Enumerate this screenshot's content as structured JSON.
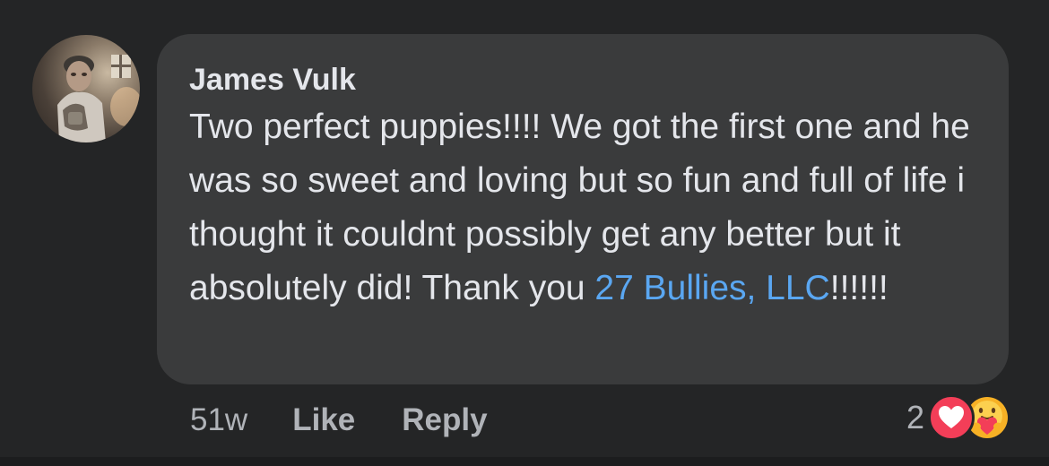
{
  "comment": {
    "author": "James Vulk",
    "text_before_mention": "Two perfect puppies!!!! We got the first one and he was so sweet and loving but so fun and full of life i thought it couldnt possibly get any better but it absolutely did! Thank you ",
    "mention": "27 Bullies, LLC",
    "text_after_mention": "!!!!!!",
    "timestamp": "51w",
    "like_label": "Like",
    "reply_label": "Reply",
    "reaction_count": "2",
    "reactions": [
      "heart-reaction-icon",
      "care-reaction-icon"
    ]
  },
  "colors": {
    "background": "#242526",
    "bubble": "#3a3b3c",
    "text": "#e4e6eb",
    "secondary_text": "#b0b3b8",
    "mention": "#5aa7f2",
    "love": "#f33e58",
    "care": "#f7b125"
  }
}
